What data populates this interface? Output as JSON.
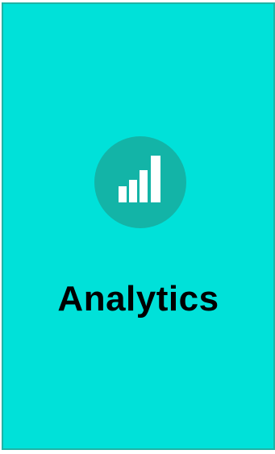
{
  "card": {
    "title": "Analytics",
    "icon": "bar-chart-signal-icon",
    "background_color": "#00e1d9",
    "border_color": "#1fb3a6",
    "icon_circle_color": "#13b4a7",
    "icon_color": "#ffffff"
  }
}
